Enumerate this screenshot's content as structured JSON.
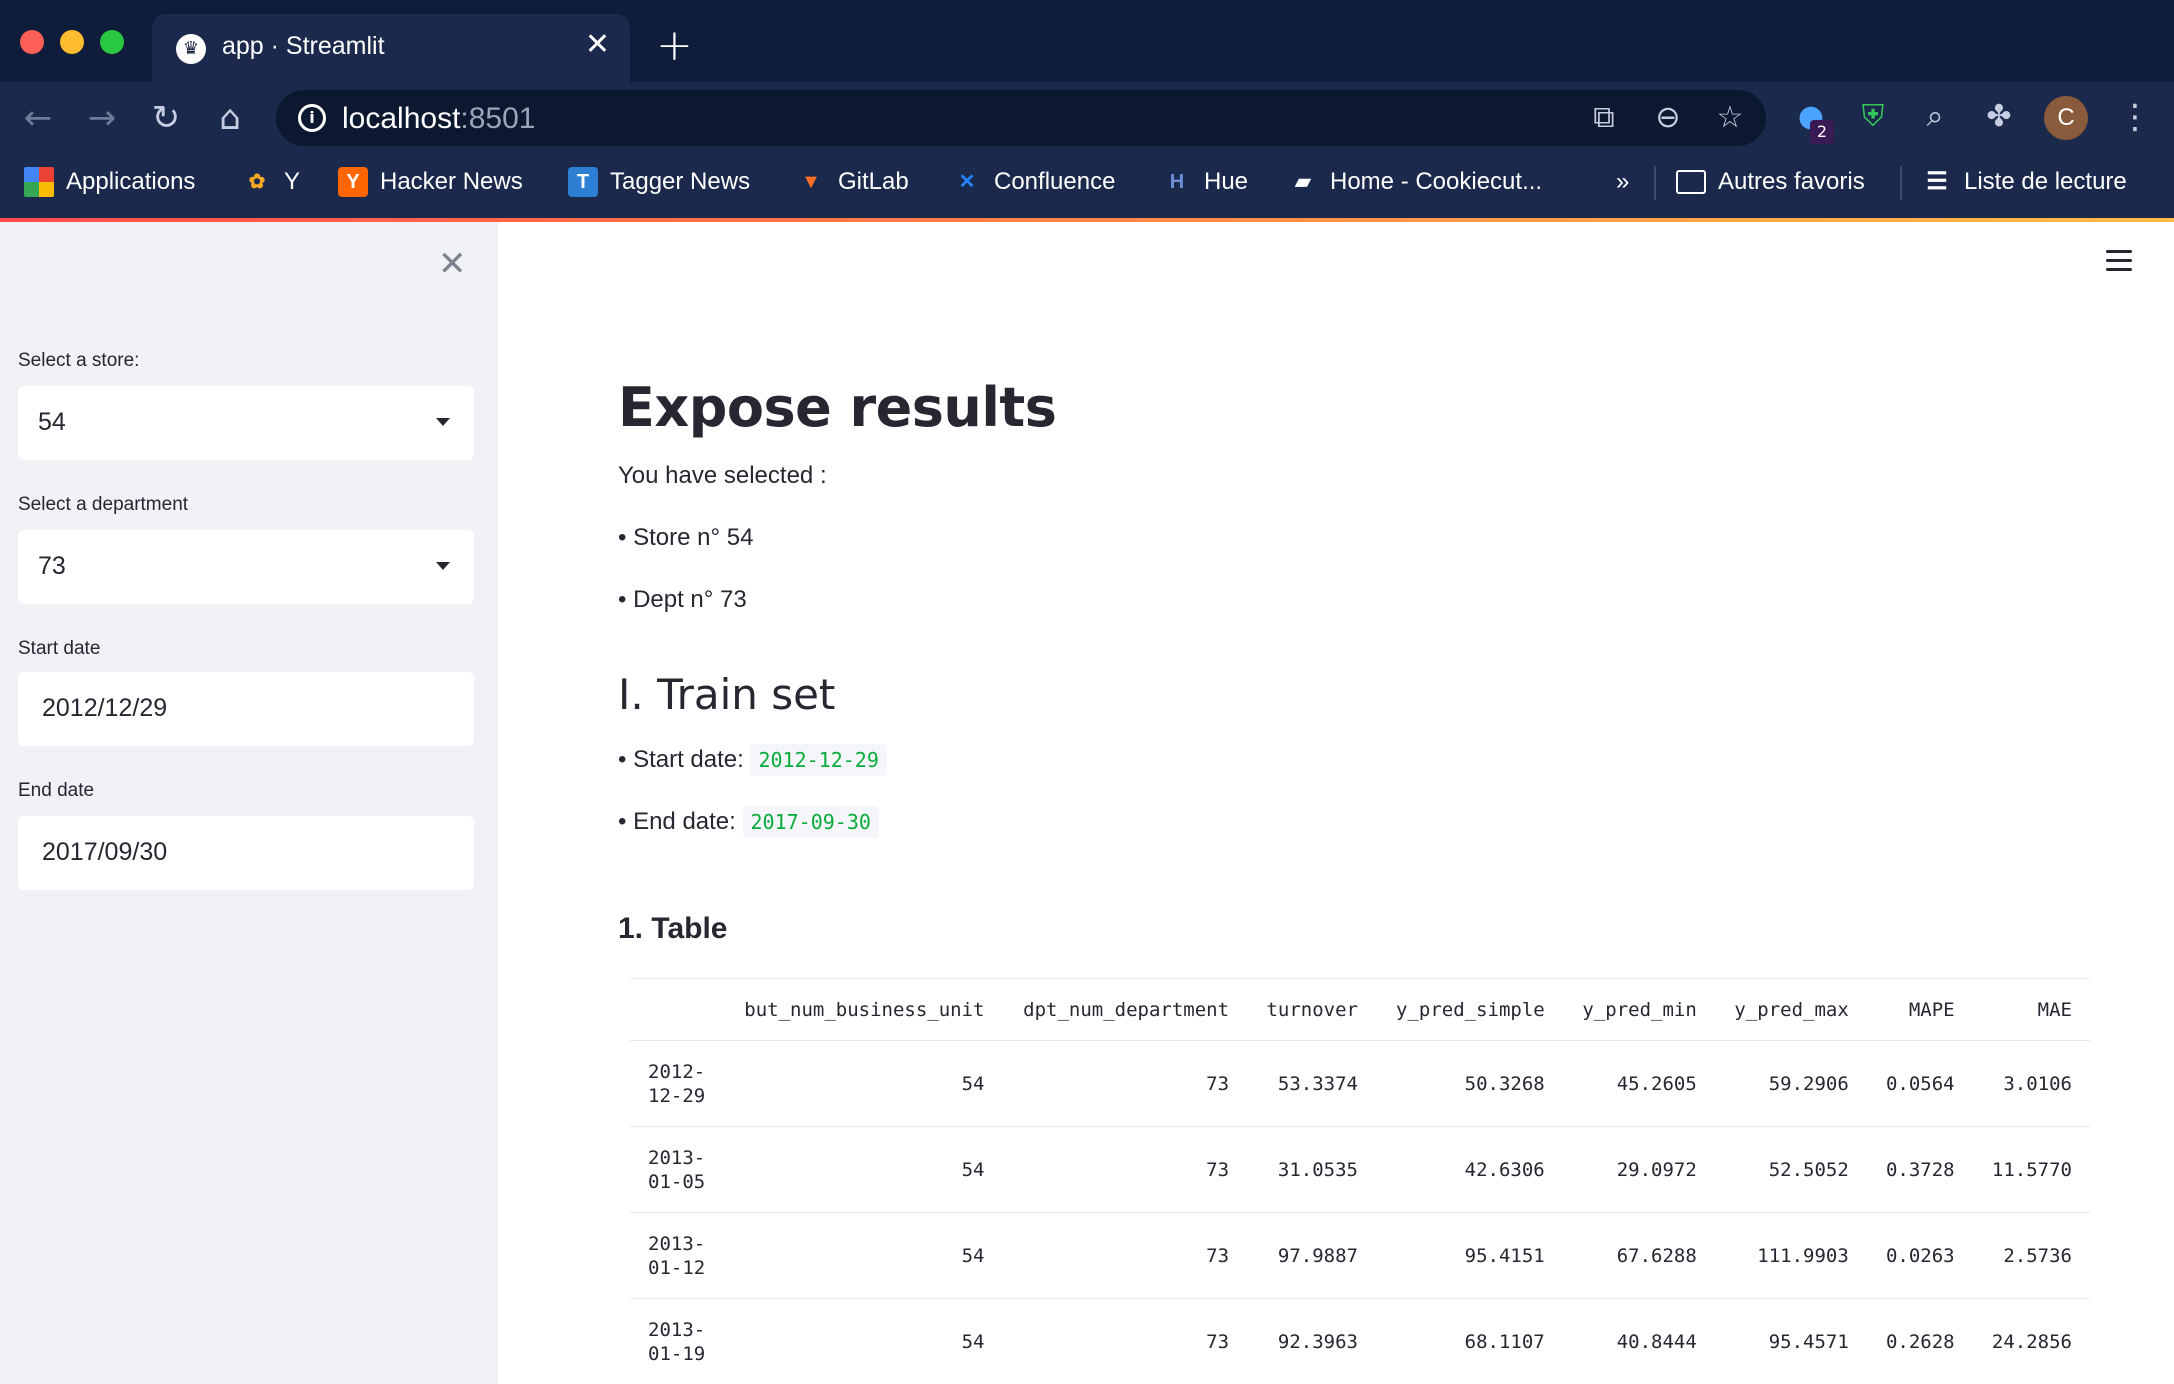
{
  "browser": {
    "tab_title": "app · Streamlit",
    "url_host": "localhost",
    "url_port": ":8501",
    "extension_badge": "2",
    "profile_initial": "C",
    "bookmarks": [
      {
        "label": "Applications",
        "icon": "apps-grid-icon"
      },
      {
        "label": "Y",
        "icon": "pinwheel-icon"
      },
      {
        "label": "Hacker News",
        "icon": "hacker-news-icon"
      },
      {
        "label": "Tagger News",
        "icon": "tagger-news-icon"
      },
      {
        "label": "GitLab",
        "icon": "gitlab-icon"
      },
      {
        "label": "Confluence",
        "icon": "confluence-icon"
      },
      {
        "label": "Hue",
        "icon": "hue-icon"
      },
      {
        "label": "Home - Cookiecut...",
        "icon": "book-icon"
      }
    ],
    "overflow": "»",
    "other_bookmarks": "Autres favoris",
    "reading_list": "Liste de lecture",
    "accent_colors": {
      "start": "#ff4b4b",
      "end": "#ffbd45"
    }
  },
  "sidebar": {
    "store_label": "Select a store:",
    "store_value": "54",
    "department_label": "Select a department",
    "department_value": "73",
    "start_label": "Start date",
    "start_value": "2012/12/29",
    "end_label": "End date",
    "end_value": "2017/09/30"
  },
  "main": {
    "title": "Expose results",
    "selected_intro": "You have selected :",
    "store_line": "• Store n° 54",
    "dept_line": "• Dept n° 73",
    "train_heading": "I. Train set",
    "start_prefix": "• Start date: ",
    "start_code": "2012-12-29",
    "end_prefix": "• End date: ",
    "end_code": "2017-09-30",
    "table_heading": "1. Table",
    "table": {
      "columns": [
        "",
        "but_num_business_unit",
        "dpt_num_department",
        "turnover",
        "y_pred_simple",
        "y_pred_min",
        "y_pred_max",
        "MAPE",
        "MAE"
      ],
      "rows": [
        [
          "2012-12-29",
          "54",
          "73",
          "53.3374",
          "50.3268",
          "45.2605",
          "59.2906",
          "0.0564",
          "3.0106"
        ],
        [
          "2013-01-05",
          "54",
          "73",
          "31.0535",
          "42.6306",
          "29.0972",
          "52.5052",
          "0.3728",
          "11.5770"
        ],
        [
          "2013-01-12",
          "54",
          "73",
          "97.9887",
          "95.4151",
          "67.6288",
          "111.9903",
          "0.0263",
          "2.5736"
        ],
        [
          "2013-01-19",
          "54",
          "73",
          "92.3963",
          "68.1107",
          "40.8444",
          "95.4571",
          "0.2628",
          "24.2856"
        ]
      ]
    },
    "code_color": "#09ab3b"
  }
}
